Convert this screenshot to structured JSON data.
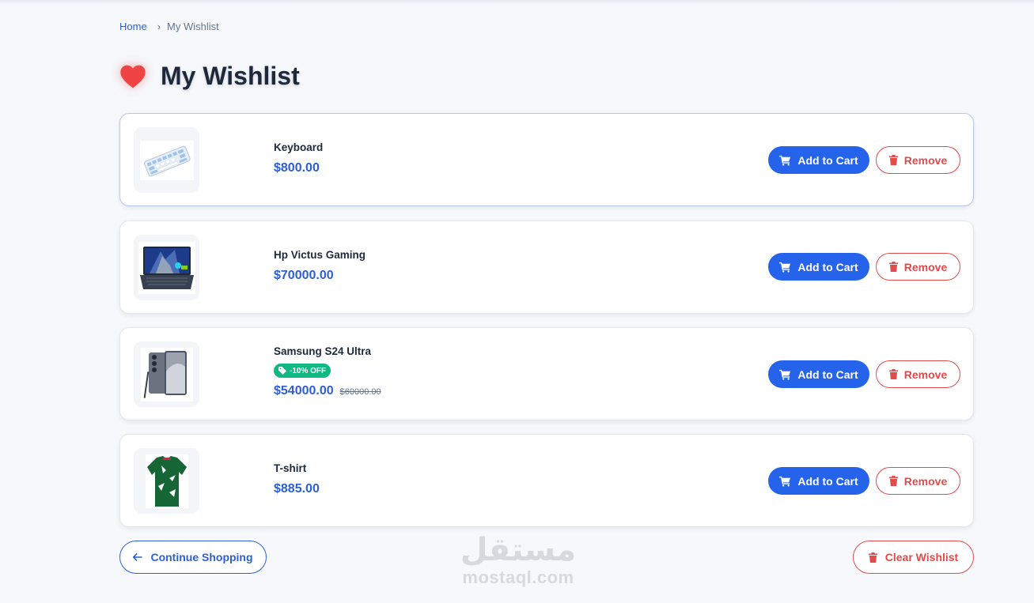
{
  "breadcrumb": {
    "home": "Home",
    "separator": "›",
    "current": "My Wishlist"
  },
  "page": {
    "title": "My Wishlist",
    "icon": "heart-icon"
  },
  "colors": {
    "primary": "#2563eb",
    "danger": "#e14b4b",
    "success": "#10b981",
    "heart": "#ef4444"
  },
  "items": [
    {
      "name": "Keyboard",
      "price": "$800.00",
      "thumb_icon": "keyboard-image"
    },
    {
      "name": "Hp Victus Gaming",
      "price": "$70000.00",
      "thumb_icon": "laptop-image"
    },
    {
      "name": "Samsung S24 Ultra",
      "price": "$54000.00",
      "old_price": "$60000.00",
      "badge": "-10% OFF",
      "thumb_icon": "phone-image"
    },
    {
      "name": "T-shirt",
      "price": "$885.00",
      "thumb_icon": "tshirt-image"
    }
  ],
  "actions": {
    "add_to_cart": "Add to Cart",
    "remove": "Remove"
  },
  "footer": {
    "continue_label": "Continue Shopping",
    "clear_label": "Clear Wishlist"
  },
  "watermark": {
    "arabic": "مستقل",
    "latin": "mostaql.com"
  }
}
